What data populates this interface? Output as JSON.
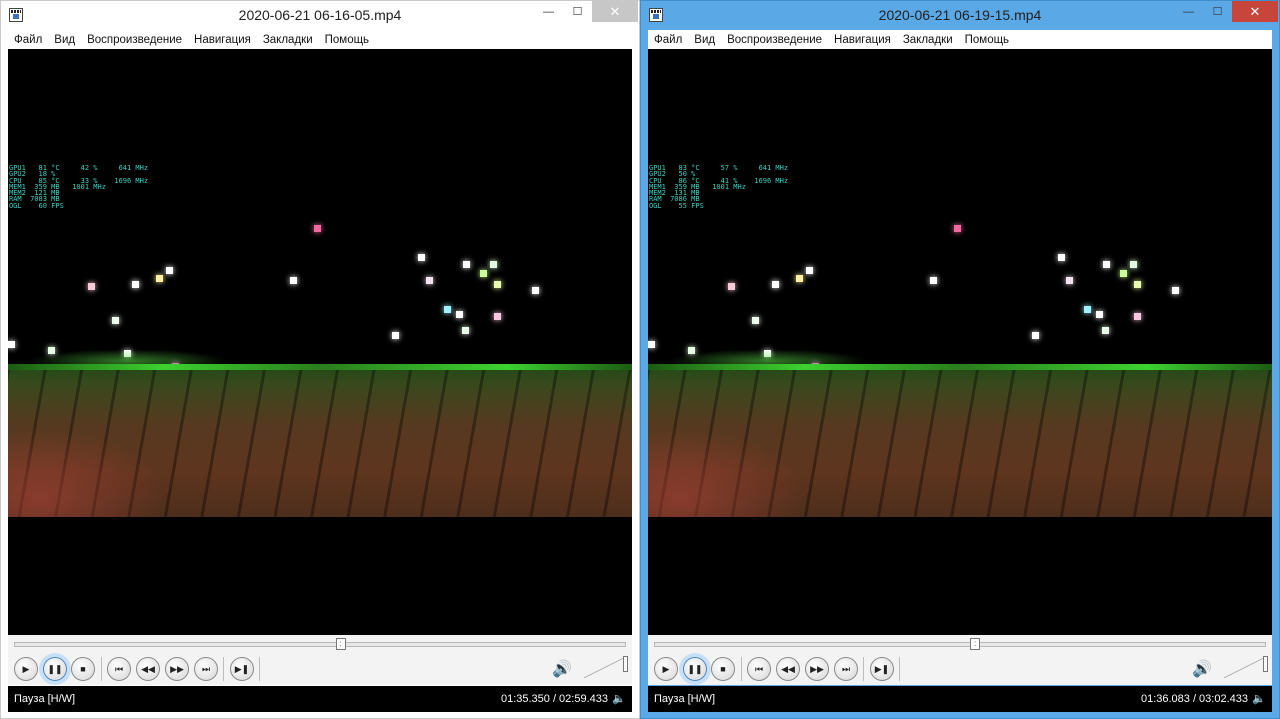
{
  "menu": [
    "Файл",
    "Вид",
    "Воспроизведение",
    "Навигация",
    "Закладки",
    "Помощь"
  ],
  "windows": [
    {
      "title": "2020-06-21 06-16-05.mp4",
      "active": false,
      "seek_fraction": 0.532,
      "status_text": "Пауза [H/W]",
      "time_text": "01:35.350 / 02:59.433",
      "hud": {
        "gpu1": "GPU1   81 °C     42 %     641 MHz",
        "gpu2": "GPU2   18 %",
        "cpu": "CPU    85 °C     33 %    1696 MHz",
        "mem1": "MEM1  359 MB   1001 MHz",
        "mem2": "MEM2  121 MB",
        "ram": "RAM  7083 MB",
        "ogl": "OGL    60 FPS"
      }
    },
    {
      "title": "2020-06-21 06-19-15.mp4",
      "active": true,
      "seek_fraction": 0.523,
      "status_text": "Пауза [H/W]",
      "time_text": "01:36.083 / 03:02.433",
      "hud": {
        "gpu1": "GPU1   83 °C     57 %     641 MHz",
        "gpu2": "GPU2   50 %",
        "cpu": "CPU    86 °C     41 %    1696 MHz",
        "mem1": "MEM1  359 MB   1001 MHz",
        "mem2": "MEM2  131 MB",
        "ram": "RAM  7086 MB",
        "ogl": "OGL    55 FPS"
      }
    }
  ],
  "window_buttons": {
    "minimize": "—",
    "maximize": "☐",
    "close": "✕"
  },
  "controls": {
    "play": "▶",
    "pause": "❚❚",
    "stop": "■",
    "prev": "⏮",
    "rewind": "◀◀",
    "forward": "▶▶",
    "next": "⏭",
    "frame_step": "▶❚",
    "speaker": "🔊",
    "mute": "🔈"
  },
  "colors": {
    "active_frame": "#5aa9e6",
    "close_active": "#c7453a",
    "hud_value": "#39d3c4",
    "hud_label": "#3ab95f"
  }
}
